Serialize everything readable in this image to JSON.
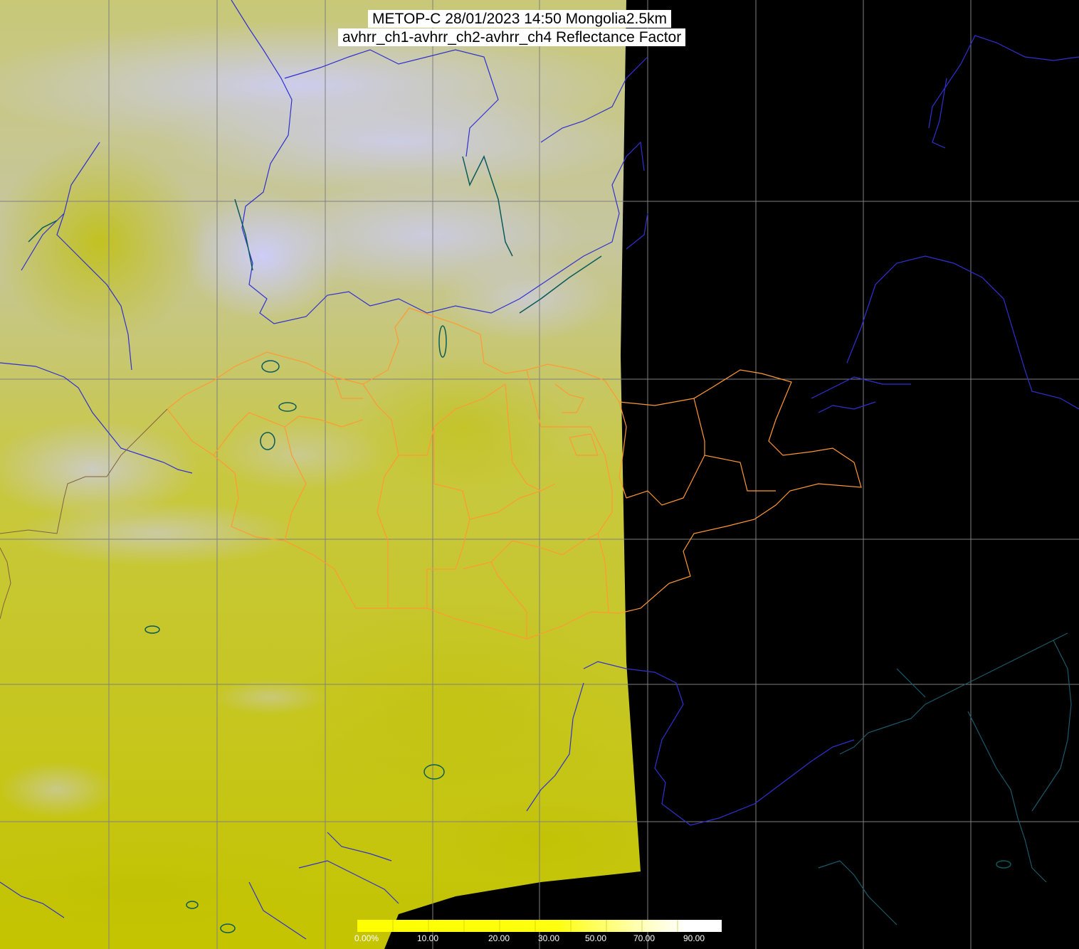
{
  "title": {
    "line1": "METOP-C 28/01/2023 14:50 Mongolia2.5km",
    "line2": "avhrr_ch1-avhrr_ch2-avhrr_ch4 Reflectance Factor"
  },
  "colors": {
    "background": "#000000",
    "imagery_yellow": "#c8c800",
    "imagery_pale": "#c4c4ea",
    "imagery_white": "#cfcff7",
    "grid": "#808080",
    "coast_river": "#3030d0",
    "country_border": "#ff9933",
    "lake": "#0a5a5a",
    "coast_dark": "#1a5a6a"
  },
  "legend": {
    "ticks": [
      "0.00%",
      "10.00",
      "20.00",
      "30.00",
      "50.00",
      "70.00",
      "90.00"
    ],
    "ramp": [
      "#ffff00",
      "#ffff00",
      "#ffff10",
      "#ffff40",
      "#ffff80",
      "#ffffc0",
      "#ffffff"
    ]
  }
}
